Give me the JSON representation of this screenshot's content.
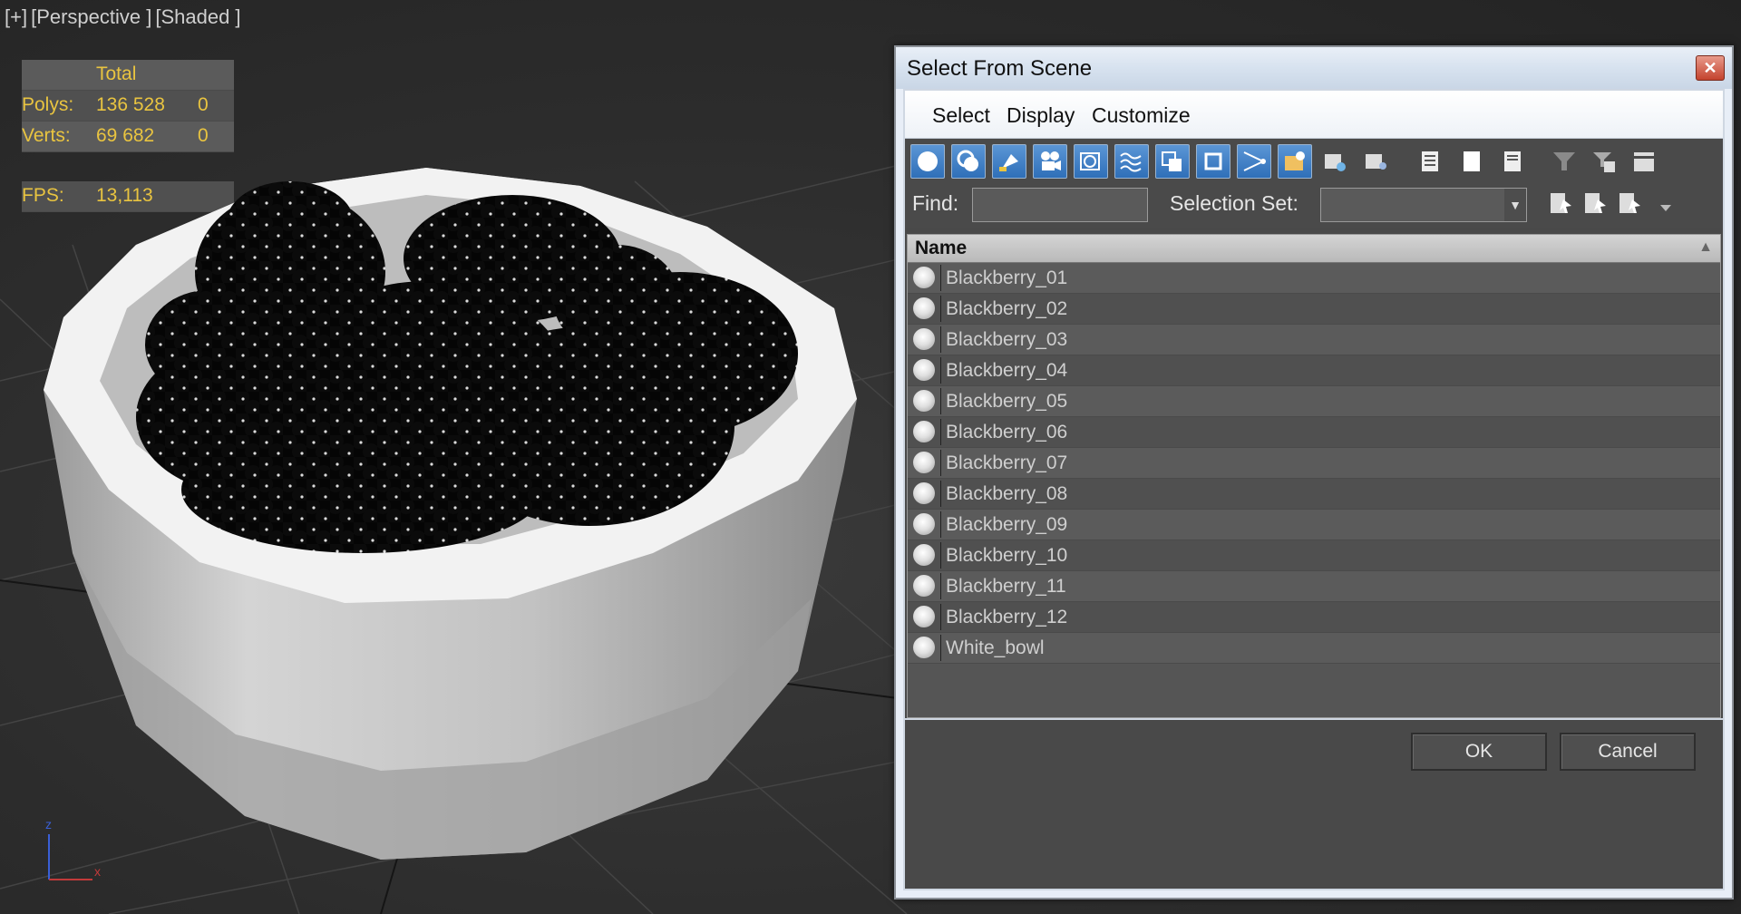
{
  "viewport": {
    "labels": [
      "[+]",
      "[Perspective ]",
      "[Shaded ]"
    ],
    "stats": {
      "header": "Total",
      "rows": [
        {
          "label": "Polys:",
          "total": "136 528",
          "selected": "0"
        },
        {
          "label": "Verts:",
          "total": "69 682",
          "selected": "0"
        }
      ],
      "fps_label": "FPS:",
      "fps_value": "13,113"
    },
    "axis_labels": {
      "z": "z",
      "x": "x"
    }
  },
  "dialog": {
    "title": "Select From Scene",
    "close_glyph": "✕",
    "menu": [
      "Select",
      "Display",
      "Customize"
    ],
    "toolbar_icons": [
      "geometry-icon",
      "shapes-icon",
      "lights-icon",
      "cameras-icon",
      "helpers-icon",
      "space-warps-icon",
      "groups-icon",
      "xrefs-icon",
      "bones-icon",
      "containers-icon",
      "frozen-objects-icon",
      "hidden-objects-icon",
      "select-all-icon",
      "select-none-icon",
      "select-invert-icon",
      "filter-icon",
      "filter-settings-icon",
      "layer-icon"
    ],
    "find_label": "Find:",
    "find_value": "",
    "selection_set_label": "Selection Set:",
    "selection_set_value": "",
    "list": {
      "column_header": "Name",
      "items": [
        "Blackberry_01",
        "Blackberry_02",
        "Blackberry_03",
        "Blackberry_04",
        "Blackberry_05",
        "Blackberry_06",
        "Blackberry_07",
        "Blackberry_08",
        "Blackberry_09",
        "Blackberry_10",
        "Blackberry_11",
        "Blackberry_12",
        "White_bowl"
      ]
    },
    "ok_label": "OK",
    "cancel_label": "Cancel"
  },
  "colors": {
    "stats_text": "#e9c440",
    "toolbar_active": "#2f6fb8",
    "list_background": "#555555"
  }
}
